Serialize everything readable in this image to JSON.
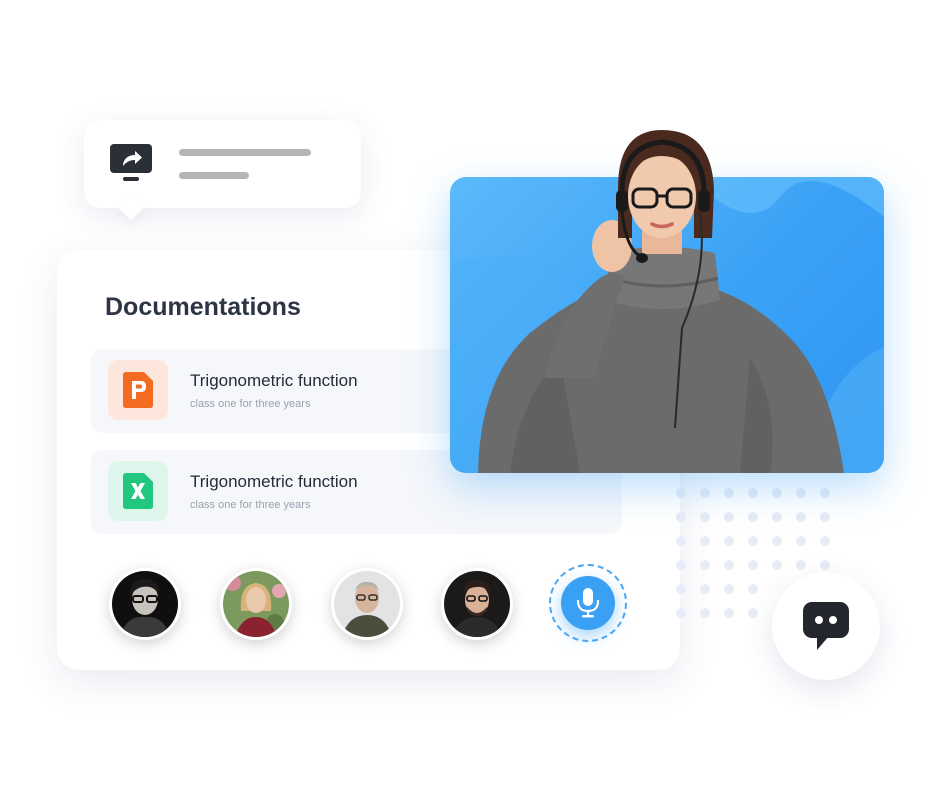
{
  "share_card": {
    "icon": "screen-share-icon"
  },
  "documentations": {
    "title": "Documentations",
    "items": [
      {
        "icon": "powerpoint-file-icon",
        "icon_letter": "P",
        "title": "Trigonometric function",
        "subtitle": "class one for three years",
        "accent": "#f26b21"
      },
      {
        "icon": "excel-file-icon",
        "icon_letter": "X",
        "title": "Trigonometric function",
        "subtitle": "class one for three years",
        "accent": "#22c77f"
      }
    ]
  },
  "participants": [
    {
      "icon": "participant-avatar"
    },
    {
      "icon": "participant-avatar"
    },
    {
      "icon": "participant-avatar"
    },
    {
      "icon": "participant-avatar"
    }
  ],
  "controls": {
    "mic_icon": "microphone-icon",
    "chat_icon": "chat-bubble-icon",
    "accent": "#3aa0f4"
  },
  "video": {
    "background": "#3aa2f6"
  }
}
